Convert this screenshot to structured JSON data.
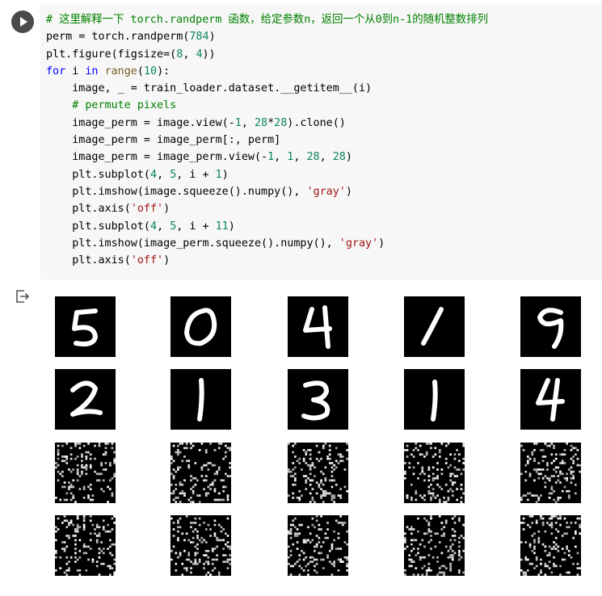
{
  "cell": {
    "run_button_icon": "play-icon",
    "output_icon": "output-exit-icon",
    "code_lines": [
      [
        {
          "t": "# 这里解释一下 torch.randperm 函数，给定参数n，返回一个从0到n-1的随机整数排列",
          "c": "cmt"
        }
      ],
      [
        {
          "t": "perm = torch.randperm("
        },
        {
          "t": "784",
          "c": "num"
        },
        {
          "t": ")"
        }
      ],
      [
        {
          "t": "plt.figure(figsize=("
        },
        {
          "t": "8",
          "c": "num"
        },
        {
          "t": ", "
        },
        {
          "t": "4",
          "c": "num"
        },
        {
          "t": "))"
        }
      ],
      [
        {
          "t": "for",
          "c": "kw"
        },
        {
          "t": " i "
        },
        {
          "t": "in",
          "c": "kw"
        },
        {
          "t": " "
        },
        {
          "t": "range",
          "c": "fn"
        },
        {
          "t": "("
        },
        {
          "t": "10",
          "c": "num"
        },
        {
          "t": "):"
        }
      ],
      [
        {
          "t": "    image, _ = train_loader.dataset.__getitem__(i)"
        }
      ],
      [
        {
          "t": "    "
        },
        {
          "t": "# permute pixels",
          "c": "cmt"
        }
      ],
      [
        {
          "t": "    image_perm = image.view(-"
        },
        {
          "t": "1",
          "c": "num"
        },
        {
          "t": ", "
        },
        {
          "t": "28",
          "c": "num"
        },
        {
          "t": "*"
        },
        {
          "t": "28",
          "c": "num"
        },
        {
          "t": ").clone()"
        }
      ],
      [
        {
          "t": "    image_perm = image_perm[:, perm]"
        }
      ],
      [
        {
          "t": "    image_perm = image_perm.view(-"
        },
        {
          "t": "1",
          "c": "num"
        },
        {
          "t": ", "
        },
        {
          "t": "1",
          "c": "num"
        },
        {
          "t": ", "
        },
        {
          "t": "28",
          "c": "num"
        },
        {
          "t": ", "
        },
        {
          "t": "28",
          "c": "num"
        },
        {
          "t": ")"
        }
      ],
      [
        {
          "t": "    plt.subplot("
        },
        {
          "t": "4",
          "c": "num"
        },
        {
          "t": ", "
        },
        {
          "t": "5",
          "c": "num"
        },
        {
          "t": ", i + "
        },
        {
          "t": "1",
          "c": "num"
        },
        {
          "t": ")"
        }
      ],
      [
        {
          "t": "    plt.imshow(image.squeeze().numpy(), "
        },
        {
          "t": "'gray'",
          "c": "str"
        },
        {
          "t": ")"
        }
      ],
      [
        {
          "t": "    plt.axis("
        },
        {
          "t": "'off'",
          "c": "str"
        },
        {
          "t": ")"
        }
      ],
      [
        {
          "t": "    plt.subplot("
        },
        {
          "t": "4",
          "c": "num"
        },
        {
          "t": ", "
        },
        {
          "t": "5",
          "c": "num"
        },
        {
          "t": ", i + "
        },
        {
          "t": "11",
          "c": "num"
        },
        {
          "t": ")"
        }
      ],
      [
        {
          "t": "    plt.imshow(image_perm.squeeze().numpy(), "
        },
        {
          "t": "'gray'",
          "c": "str"
        },
        {
          "t": ")"
        }
      ],
      [
        {
          "t": "    plt.axis("
        },
        {
          "t": "'off'",
          "c": "str"
        },
        {
          "t": ")"
        }
      ]
    ]
  },
  "output": {
    "digits": [
      "5",
      "0",
      "4",
      "1",
      "9",
      "2",
      "1",
      "3",
      "1",
      "4"
    ],
    "permuted_panels": 10
  }
}
